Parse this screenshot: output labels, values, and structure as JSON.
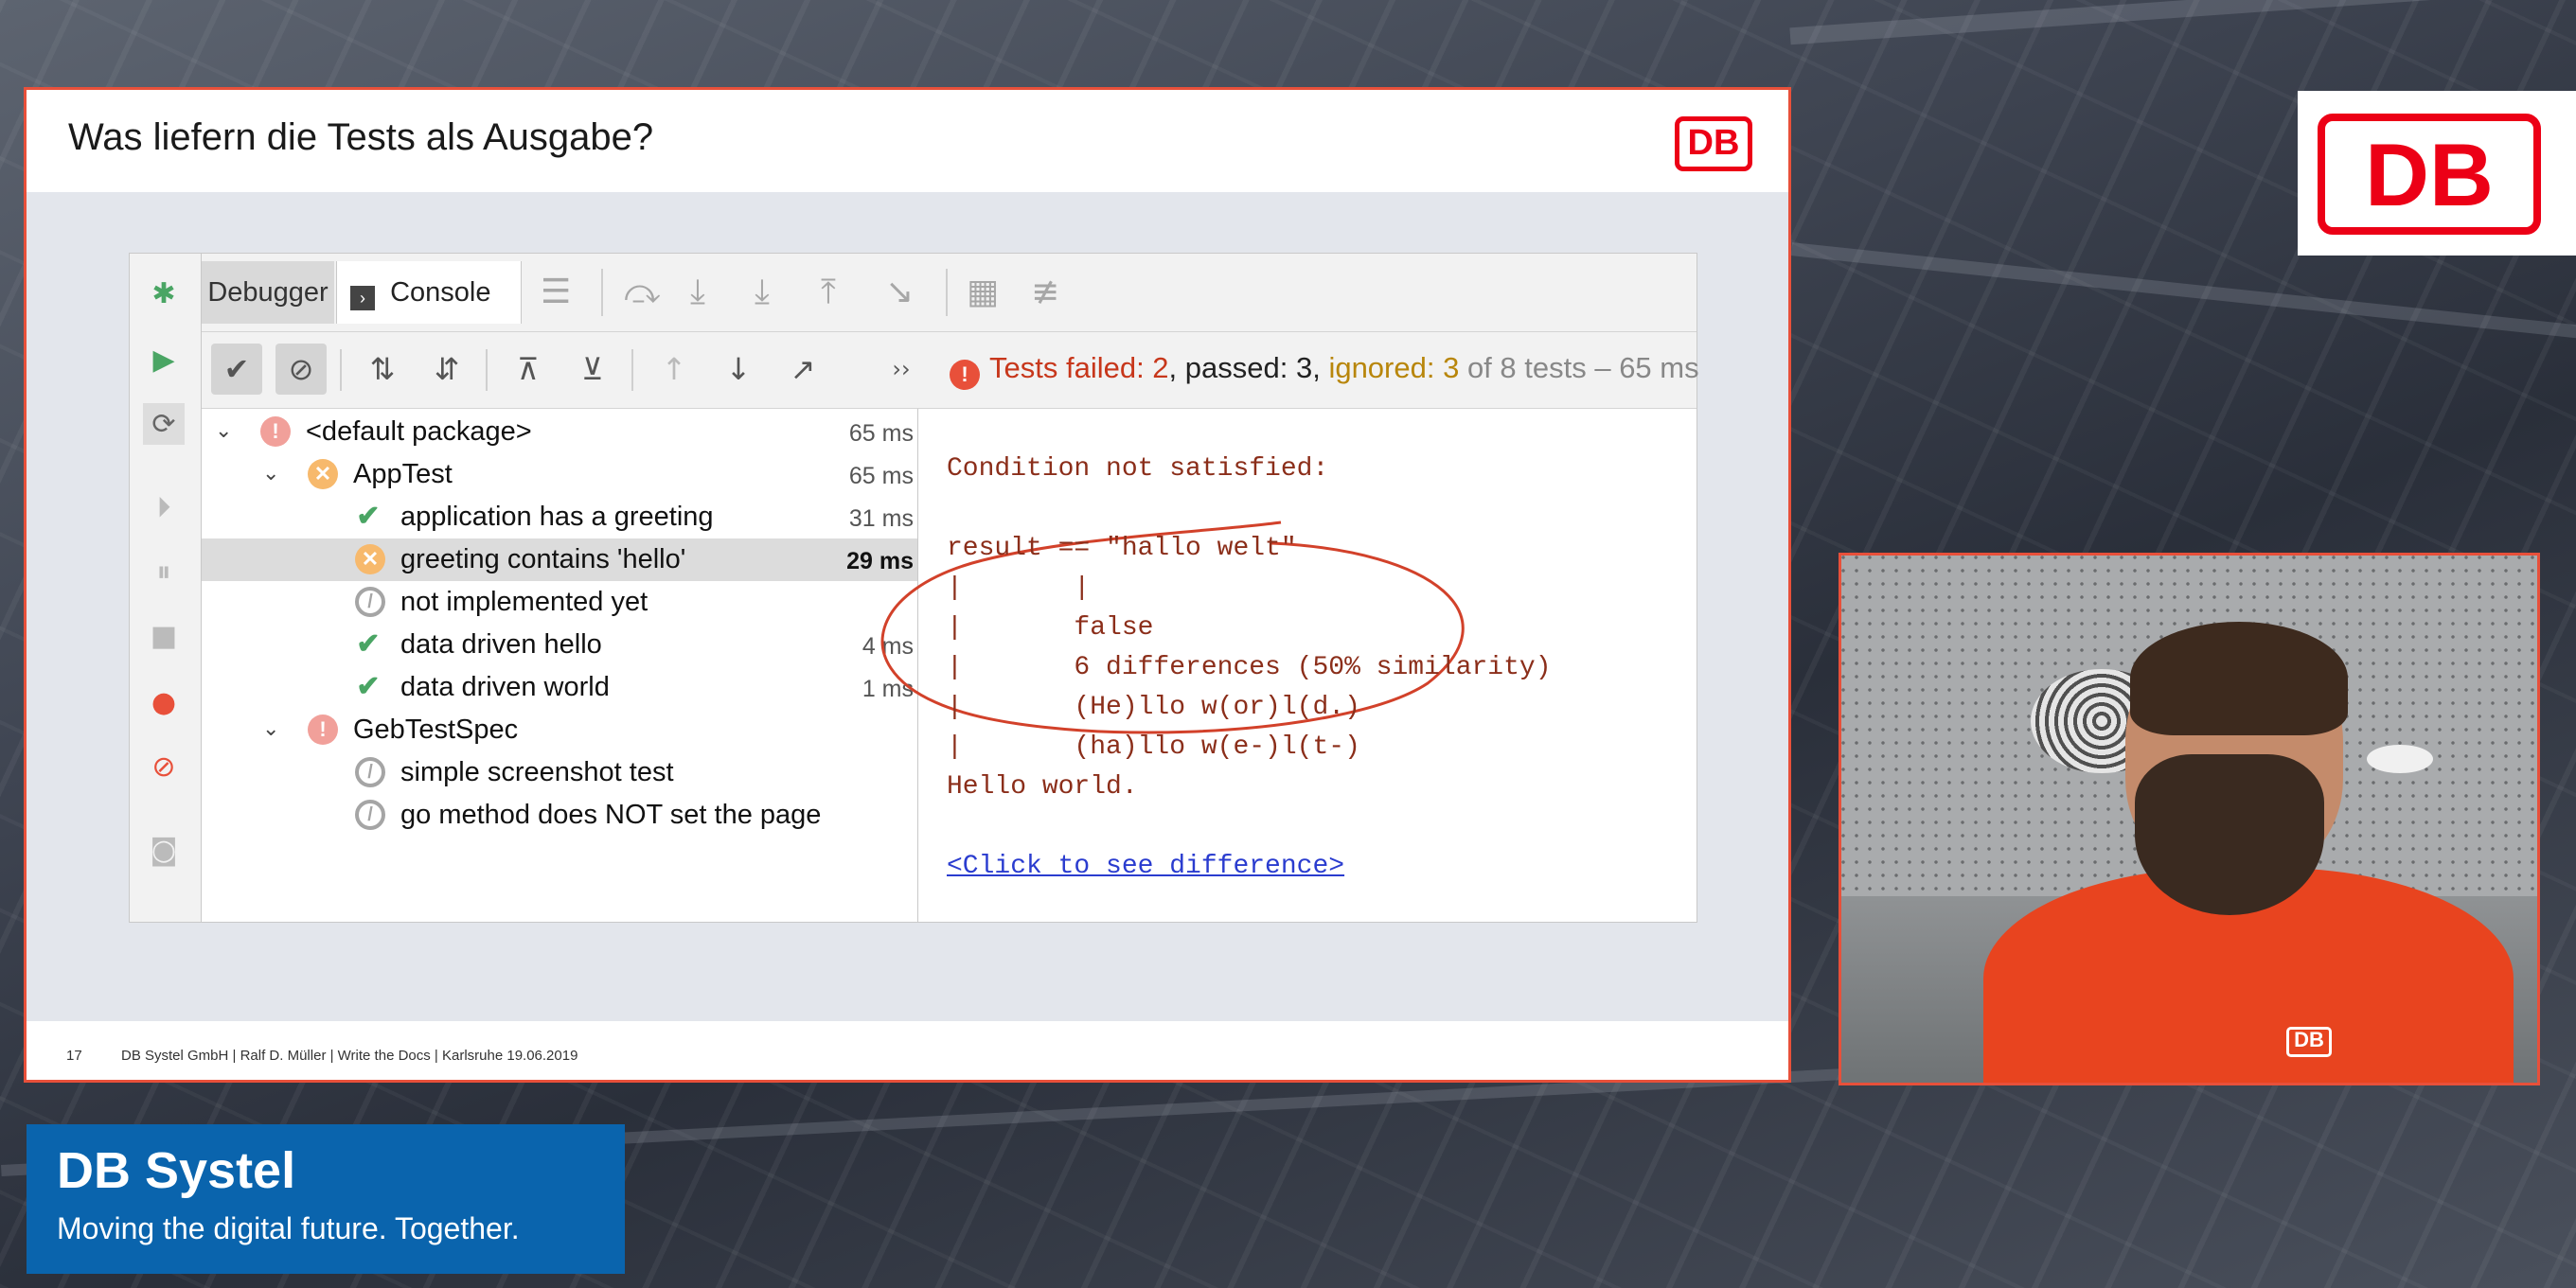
{
  "slide": {
    "title": "Was liefern die Tests als Ausgabe?",
    "logo_text": "DB",
    "footer_page": "17",
    "footer_info": "DB Systel GmbH | Ralf D. Müller | Write the Docs | Karlsruhe 19.06.2019"
  },
  "ide": {
    "tabs": {
      "debugger": "Debugger",
      "console": "Console"
    },
    "status": {
      "failed": "Tests failed: 2",
      "passed": ", passed: 3,",
      "ignored": " ignored: 3",
      "total": " of 8 tests – 65 ms"
    },
    "tree": [
      {
        "label": "<default package>",
        "time": "65 ms",
        "status": "error",
        "icon": "error-icon"
      },
      {
        "label": "AppTest",
        "time": "65 ms",
        "status": "failed",
        "icon": "failed-icon"
      },
      {
        "label": "application has a greeting",
        "time": "31 ms",
        "status": "passed",
        "icon": "check-icon"
      },
      {
        "label": "greeting contains 'hello'",
        "time": "29 ms",
        "status": "failed",
        "icon": "failed-icon",
        "selected": true
      },
      {
        "label": "not implemented yet",
        "time": "",
        "status": "ignored",
        "icon": "ignored-icon"
      },
      {
        "label": "data driven hello",
        "time": "4 ms",
        "status": "passed",
        "icon": "check-icon"
      },
      {
        "label": "data driven world",
        "time": "1 ms",
        "status": "passed",
        "icon": "check-icon"
      },
      {
        "label": "GebTestSpec",
        "time": "",
        "status": "error",
        "icon": "error-icon"
      },
      {
        "label": "simple screenshot test",
        "time": "",
        "status": "ignored",
        "icon": "ignored-icon"
      },
      {
        "label": "go method does NOT set the page",
        "time": "",
        "status": "ignored",
        "icon": "ignored-icon"
      }
    ],
    "output": {
      "line1": "Condition not satisfied:",
      "line2": "result == \"hallo welt\"",
      "line3": "|       |",
      "line4": "|       false",
      "line5": "|       6 differences (50% similarity)",
      "line6": "|       (He)llo w(or)l(d.)",
      "line7": "|       (ha)llo w(e-)l(t-)",
      "line8": "Hello world.",
      "link": "<Click to see difference>"
    }
  },
  "corner_logo": "DB",
  "shirt_logo": "DB",
  "brand": {
    "title": "DB Systel",
    "tagline": "Moving the digital future. Together."
  },
  "colors": {
    "db_red": "#ec0016",
    "brand_blue": "#0a64ad",
    "frame_orange": "#e8503a"
  }
}
